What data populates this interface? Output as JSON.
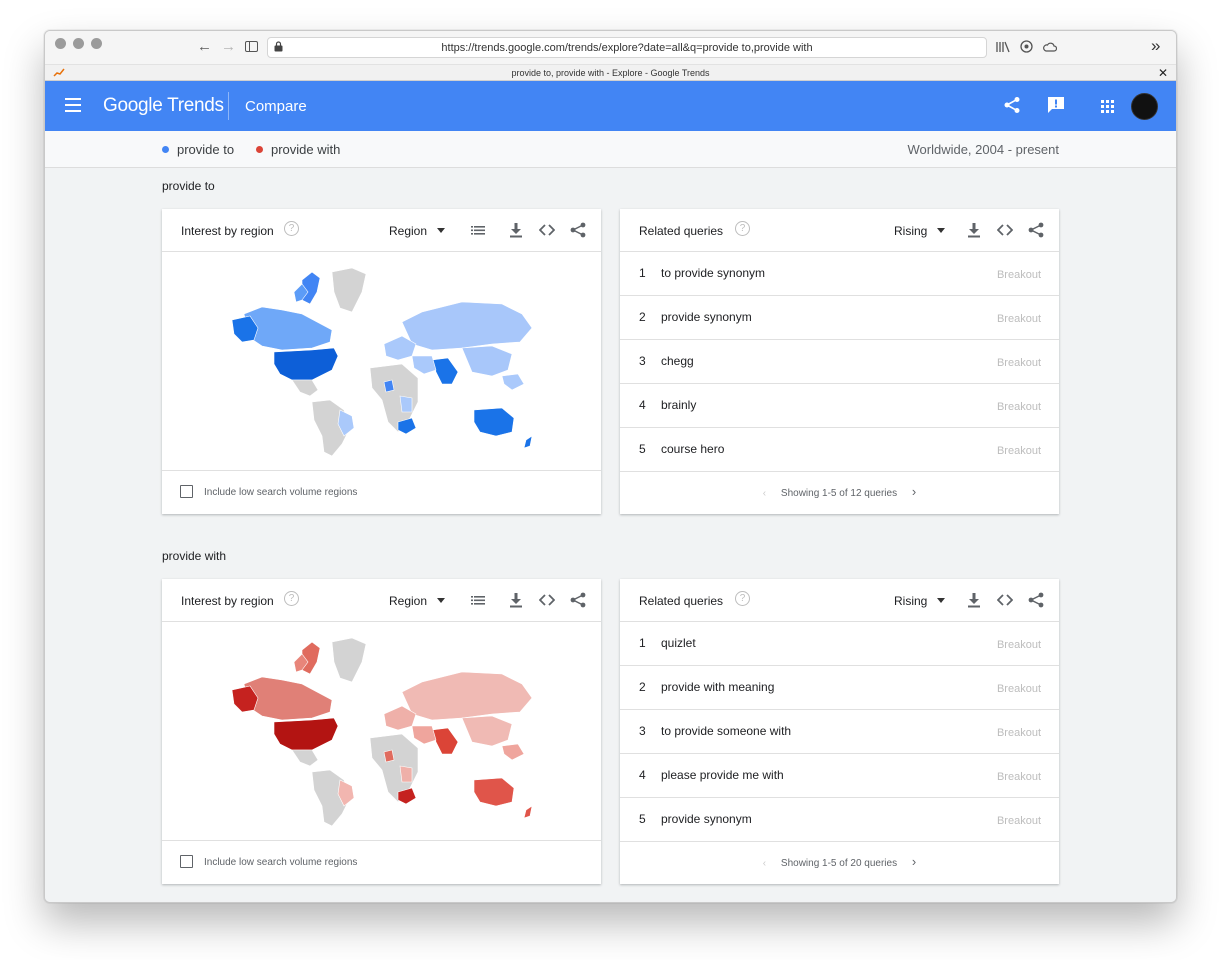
{
  "browser": {
    "url": "https://trends.google.com/trends/explore?date=all&q=provide to,provide with",
    "tab_title": "provide to, provide with - Explore - Google Trends"
  },
  "appbar": {
    "brand": "Google Trends",
    "section": "Compare",
    "color": "#4285f4"
  },
  "terms": {
    "items": [
      {
        "label": "provide to",
        "color": "#4285f4"
      },
      {
        "label": "provide with",
        "color": "#db4437"
      }
    ],
    "range": "Worldwide, 2004 - present"
  },
  "sections": [
    {
      "title": "provide to",
      "region_card": {
        "title": "Interest by region",
        "dropdown": "Region",
        "checkbox_label": "Include low search volume regions"
      },
      "queries_card": {
        "title": "Related queries",
        "dropdown": "Rising",
        "rows": [
          {
            "num": "1",
            "text": "to provide synonym",
            "value": "Breakout"
          },
          {
            "num": "2",
            "text": "provide synonym",
            "value": "Breakout"
          },
          {
            "num": "3",
            "text": "chegg",
            "value": "Breakout"
          },
          {
            "num": "4",
            "text": "brainly",
            "value": "Breakout"
          },
          {
            "num": "5",
            "text": "course hero",
            "value": "Breakout"
          }
        ],
        "pager": "Showing 1-5 of 12 queries"
      }
    },
    {
      "title": "provide with",
      "region_card": {
        "title": "Interest by region",
        "dropdown": "Region",
        "checkbox_label": "Include low search volume regions"
      },
      "queries_card": {
        "title": "Related queries",
        "dropdown": "Rising",
        "rows": [
          {
            "num": "1",
            "text": "quizlet",
            "value": "Breakout"
          },
          {
            "num": "2",
            "text": "provide with meaning",
            "value": "Breakout"
          },
          {
            "num": "3",
            "text": "to provide someone with",
            "value": "Breakout"
          },
          {
            "num": "4",
            "text": "please provide me with",
            "value": "Breakout"
          },
          {
            "num": "5",
            "text": "provide synonym",
            "value": "Breakout"
          }
        ],
        "pager": "Showing 1-5 of 20 queries"
      }
    }
  ]
}
